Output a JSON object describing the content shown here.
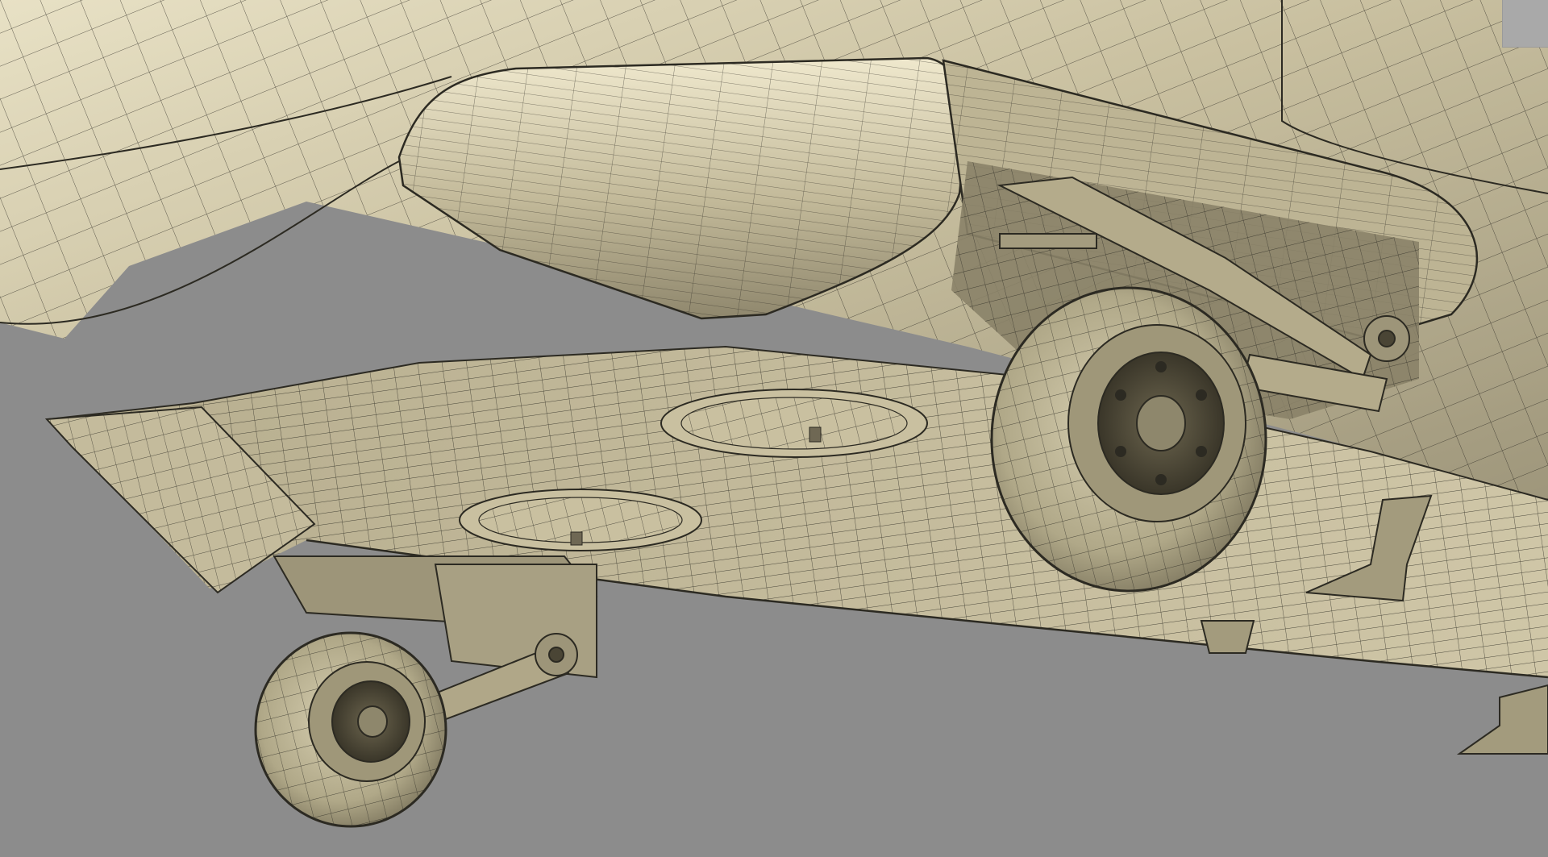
{
  "scene": {
    "subject": "",
    "view": "",
    "render_mode": "wireframe-on-shaded",
    "colors": {
      "background": "#8c8c8c",
      "surface_light": "#e5dfc4",
      "surface_mid": "#b6ad8e",
      "surface_dark": "#6f6854",
      "wire": "#2c2a22",
      "corner_panel": "#a9a9a9"
    }
  }
}
